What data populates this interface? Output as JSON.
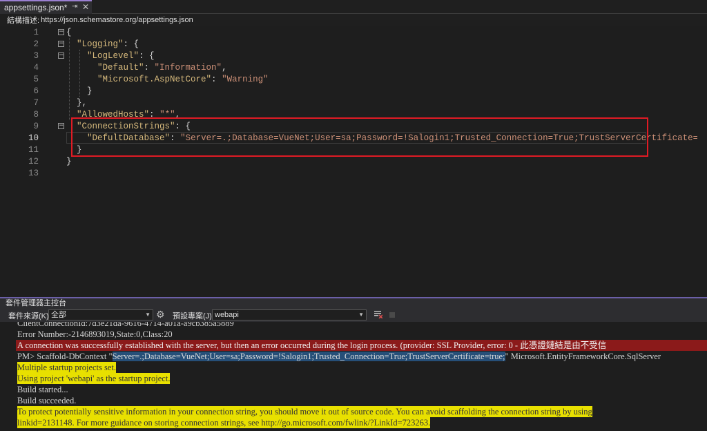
{
  "tab": {
    "title": "appsettings.json*",
    "pin_glyph": "⇥",
    "close_glyph": "✕"
  },
  "schema": {
    "label": "結構描述:",
    "url": "https://json.schemastore.org/appsettings.json"
  },
  "editor": {
    "lines": [
      {
        "n": "1",
        "fold": "⊟",
        "segs": [
          [
            "p",
            "{"
          ]
        ]
      },
      {
        "n": "2",
        "fold": "⊟",
        "segs": [
          [
            "p",
            "  "
          ],
          [
            "k",
            "\"Logging\""
          ],
          [
            "p",
            ": {"
          ]
        ]
      },
      {
        "n": "3",
        "fold": "⊟",
        "segs": [
          [
            "p",
            "    "
          ],
          [
            "k",
            "\"LogLevel\""
          ],
          [
            "p",
            ": {"
          ]
        ]
      },
      {
        "n": "4",
        "fold": "",
        "segs": [
          [
            "p",
            "      "
          ],
          [
            "k",
            "\"Default\""
          ],
          [
            "p",
            ": "
          ],
          [
            "s",
            "\"Information\""
          ],
          [
            "p",
            ","
          ]
        ]
      },
      {
        "n": "5",
        "fold": "",
        "segs": [
          [
            "p",
            "      "
          ],
          [
            "k",
            "\"Microsoft.AspNetCore\""
          ],
          [
            "p",
            ": "
          ],
          [
            "s",
            "\"Warning\""
          ]
        ]
      },
      {
        "n": "6",
        "fold": "",
        "segs": [
          [
            "p",
            "    }"
          ]
        ]
      },
      {
        "n": "7",
        "fold": "",
        "segs": [
          [
            "p",
            "  },"
          ]
        ]
      },
      {
        "n": "8",
        "fold": "",
        "segs": [
          [
            "p",
            "  "
          ],
          [
            "k",
            "\"AllowedHosts\""
          ],
          [
            "p",
            ": "
          ],
          [
            "s",
            "\"*\""
          ],
          [
            "p",
            ","
          ]
        ]
      },
      {
        "n": "9",
        "fold": "⊟",
        "segs": [
          [
            "p",
            "  "
          ],
          [
            "k",
            "\"ConnectionStrings\""
          ],
          [
            "p",
            ": {"
          ]
        ]
      },
      {
        "n": "10",
        "fold": "",
        "segs": [
          [
            "p",
            "    "
          ],
          [
            "k",
            "\"DefultDatabase\""
          ],
          [
            "p",
            ": "
          ],
          [
            "s",
            "\"Server=.;Database=VueNet;User=sa;Password=!Salogin1;Trusted_Connection=True;TrustServerCertificate=true;\""
          ]
        ]
      },
      {
        "n": "11",
        "fold": "",
        "segs": [
          [
            "p",
            "  }"
          ]
        ]
      },
      {
        "n": "12",
        "fold": "",
        "segs": [
          [
            "p",
            "}"
          ]
        ]
      },
      {
        "n": "13",
        "fold": "",
        "segs": []
      }
    ]
  },
  "pmc": {
    "title": "套件管理器主控台",
    "source_label": "套件來源(K):",
    "source_value": "全部",
    "project_label": "預設專案(J):",
    "project_value": "webapi",
    "console_lines": [
      {
        "type": "plain",
        "text": "ClientConnectionId:7d3e21da-9616-4714-a01a-a9cb385a5889"
      },
      {
        "type": "plain",
        "text": "Error Number:-2146893019,State:0,Class:20"
      },
      {
        "type": "err",
        "text": "A connection was successfully established with the server, but then an error occurred during the login process. (provider: SSL Provider, error: 0 - 此憑證鏈結是由不受信"
      },
      {
        "type": "cmd",
        "pre": "PM> Scaffold-DbContext \"",
        "sel": "Server=.;Database=VueNet;User=sa;Password=!Salogin1;Trusted_Connection=True;TrustServerCertificate=true;",
        "post": "\" Microsoft.EntityFrameworkCore.SqlServer"
      },
      {
        "type": "warn",
        "text": "Multiple startup projects set."
      },
      {
        "type": "warn",
        "text": "Using project 'webapi' as the startup project."
      },
      {
        "type": "plain",
        "text": "Build started..."
      },
      {
        "type": "plain",
        "text": "Build succeeded."
      },
      {
        "type": "warn",
        "text": "To protect potentially sensitive information in your connection string, you should move it out of source code. You can avoid scaffolding the connection string by using"
      },
      {
        "type": "warn",
        "text": "linkid=2131148. For more guidance on storing connection strings, see http://go.microsoft.com/fwlink/?LinkId=723263."
      }
    ]
  }
}
